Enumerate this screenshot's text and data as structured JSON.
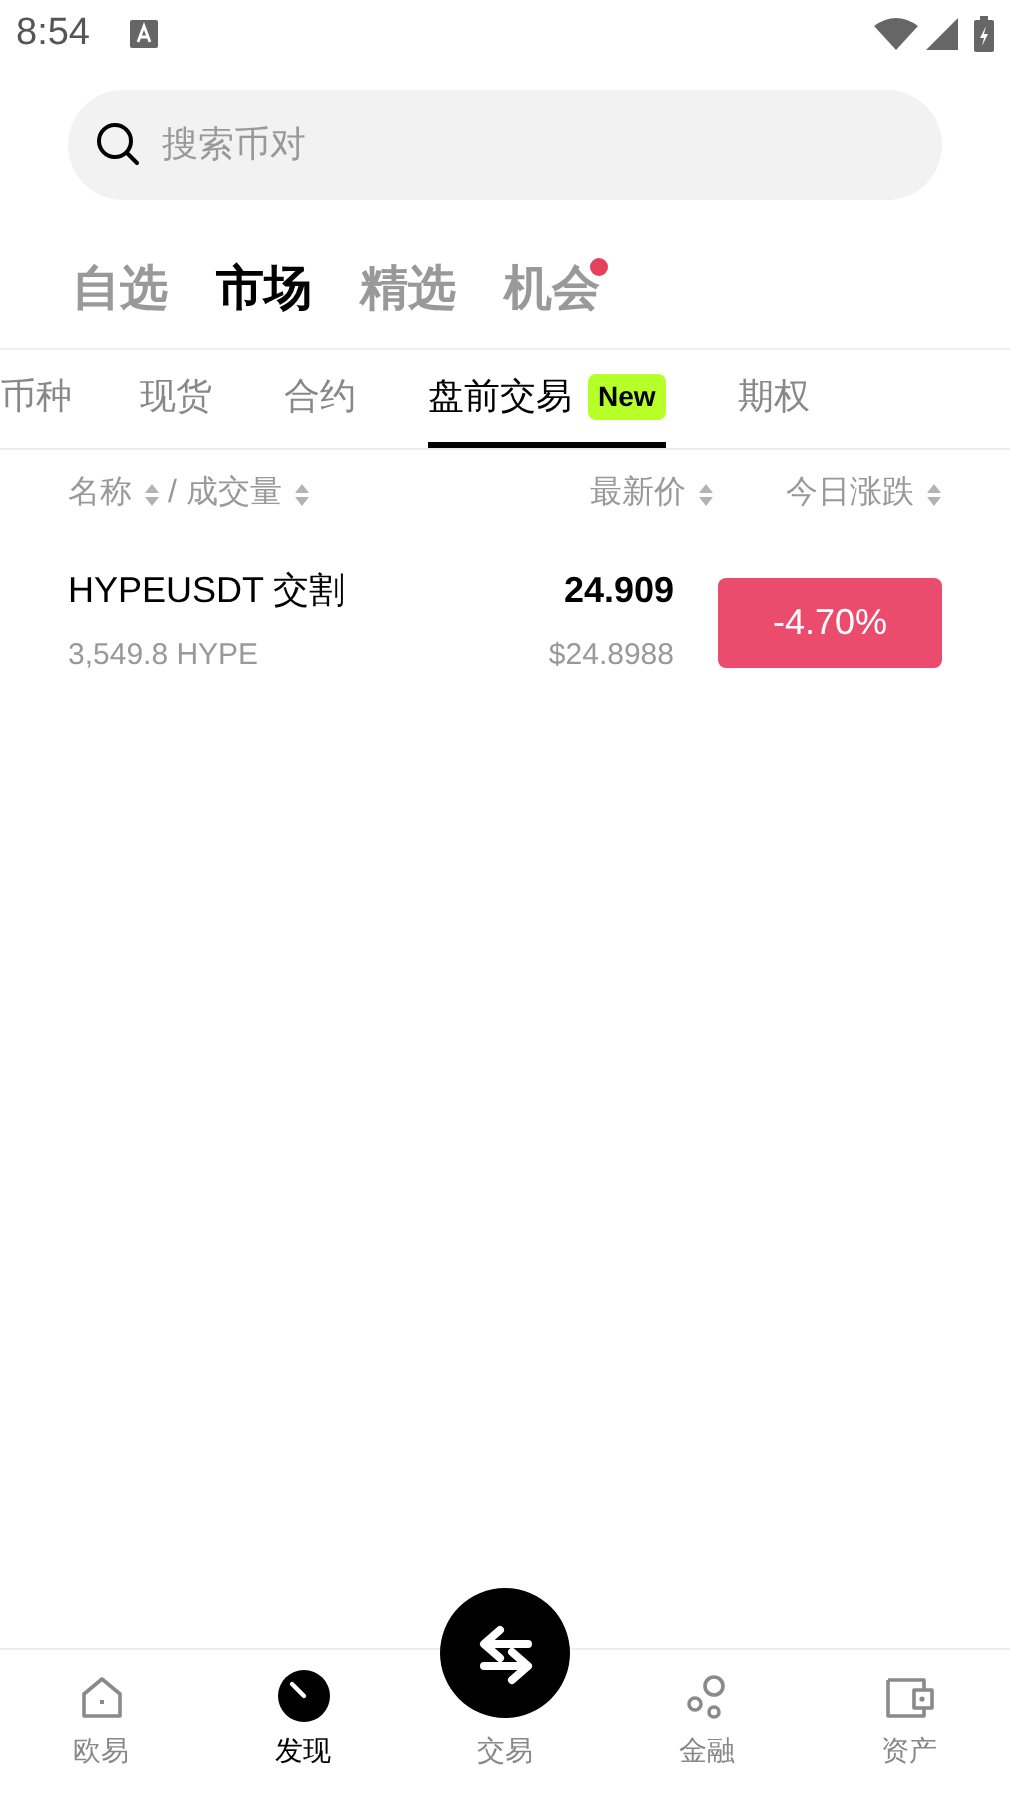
{
  "status_bar": {
    "time": "8:54"
  },
  "search": {
    "placeholder": "搜索币对"
  },
  "top_tabs": [
    {
      "label": "自选",
      "selected": false,
      "dot": false
    },
    {
      "label": "市场",
      "selected": true,
      "dot": false
    },
    {
      "label": "精选",
      "selected": false,
      "dot": false
    },
    {
      "label": "机会",
      "selected": false,
      "dot": true
    }
  ],
  "sub_tabs": [
    {
      "label": "币种",
      "selected": false
    },
    {
      "label": "现货",
      "selected": false
    },
    {
      "label": "合约",
      "selected": false
    },
    {
      "label": "盘前交易",
      "selected": true,
      "badge": "New"
    },
    {
      "label": "期权",
      "selected": false
    }
  ],
  "columns": {
    "name": "名称",
    "separator": "/ 成交量",
    "price": "最新价",
    "change": "今日涨跌"
  },
  "rows": [
    {
      "symbol": "HYPEUSDT 交割",
      "volume": "3,549.8 HYPE",
      "price": "24.909",
      "price_usd": "$24.8988",
      "change": "-4.70%",
      "color": "#eb4b6d"
    }
  ],
  "nav": [
    {
      "kind": "home",
      "label": "欧易",
      "selected": false
    },
    {
      "kind": "discover",
      "label": "发现",
      "selected": true
    },
    {
      "kind": "trade",
      "label": "交易",
      "selected": false
    },
    {
      "kind": "finance",
      "label": "金融",
      "selected": false
    },
    {
      "kind": "assets",
      "label": "资产",
      "selected": false
    }
  ]
}
